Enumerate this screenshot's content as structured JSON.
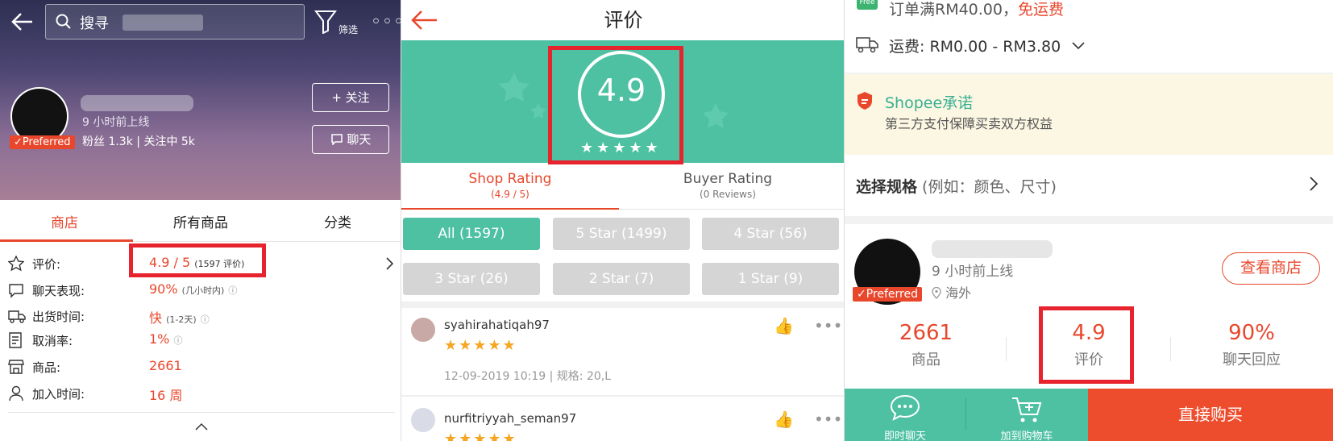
{
  "panel1": {
    "search_text": "搜寻",
    "filter_label": "筛选",
    "more": "◦◦◦",
    "preferred_badge": "✓Preferred",
    "online_status": "9 小时前上线",
    "fans_line": "粉丝 1.3k | 关注中 5k",
    "follow_button": "+ 关注",
    "chat_button": "聊天",
    "tabs": [
      "商店",
      "所有商品",
      "分类"
    ],
    "rows": [
      {
        "icon": "star-outline-icon",
        "label": "评价:",
        "value": "4.9 / 5",
        "note": "(1597 评价)"
      },
      {
        "icon": "chat-bubble-icon",
        "label": "聊天表现:",
        "value": "90%",
        "note": "(几小时内)"
      },
      {
        "icon": "delivery-truck-icon",
        "label": "出货时间:",
        "value": "快",
        "note": "(1-2天)"
      },
      {
        "icon": "cancel-doc-icon",
        "label": "取消率:",
        "value": "1%",
        "note": ""
      },
      {
        "icon": "store-icon",
        "label": "商品:",
        "value": "2661",
        "note": ""
      },
      {
        "icon": "person-icon",
        "label": "加入时间:",
        "value": "16 周",
        "note": ""
      }
    ]
  },
  "panel2": {
    "title": "评价",
    "rating": "4.9",
    "stars": "★★★★★",
    "tabs": [
      {
        "title": "Shop Rating",
        "sub": "(4.9 / 5)"
      },
      {
        "title": "Buyer Rating",
        "sub": "(0 Reviews)"
      }
    ],
    "filters": [
      "All (1597)",
      "5 Star (1499)",
      "4 Star (56)",
      "3 Star (26)",
      "2 Star (7)",
      "1 Star (9)"
    ],
    "reviews": [
      {
        "user": "syahirahatiqah97",
        "stars": "★★★★★",
        "meta": "12-09-2019 10:19 | 规格: 20,L"
      },
      {
        "user": "nurfitriyyah_seman97",
        "stars": "★★★★★",
        "meta": ""
      }
    ],
    "thumb": "👍",
    "dots": "•••"
  },
  "panel3": {
    "free_badge": "Free",
    "promo_text": "订单满RM40.00，",
    "promo_highlight": "免运费",
    "shipping": "运费: RM0.00 - RM3.80",
    "shopee_title": "Shopee承诺",
    "shopee_sub": "第三方支付保障买卖双方权益",
    "spec_bold": "选择规格",
    "spec_hint": " (例如：颜色、尺寸)",
    "online": "9 小时前上线",
    "location": "海外",
    "preferred_badge": "✓Preferred",
    "view_shop": "查看商店",
    "stats": [
      {
        "value": "2661",
        "label": "商品"
      },
      {
        "value": "4.9",
        "label": "评价"
      },
      {
        "value": "90%",
        "label": "聊天回应"
      }
    ],
    "chat_now": "即时聊天",
    "add_cart": "加到购物车",
    "buy_now": "直接购买"
  }
}
